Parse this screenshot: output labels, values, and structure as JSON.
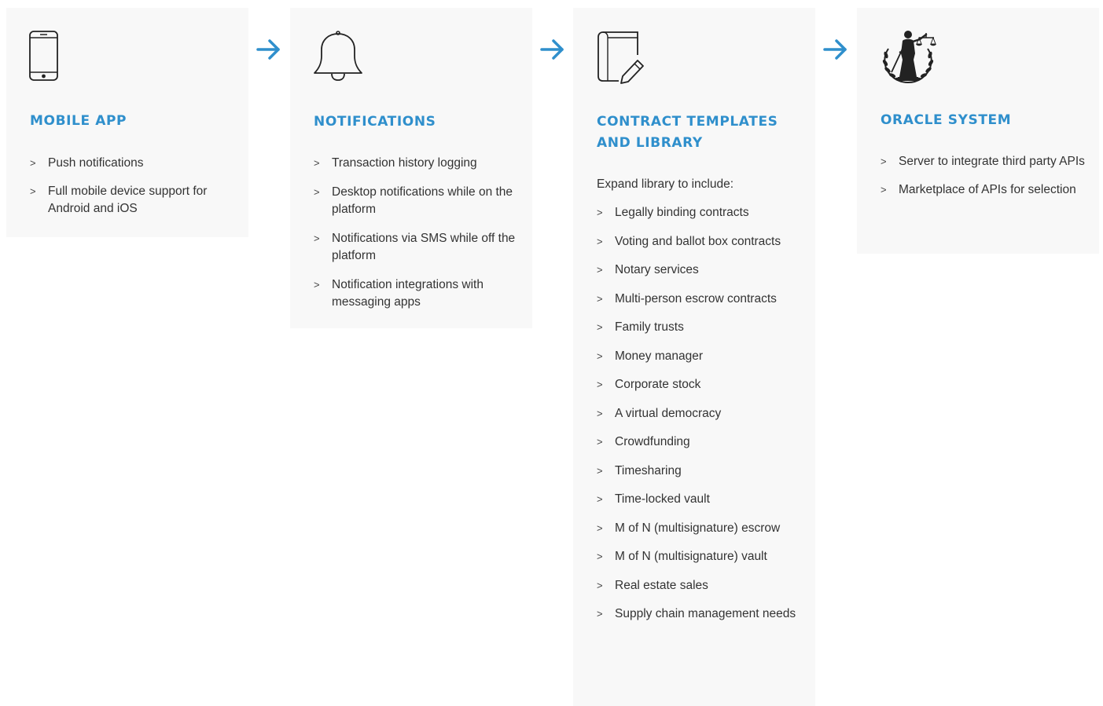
{
  "accent_color": "#2f8fcc",
  "chevron": ">",
  "cards": [
    {
      "title": "MOBILE APP",
      "icon": "mobile-phone-icon",
      "items": [
        "Push notifications",
        "Full mobile device support for Android and iOS"
      ]
    },
    {
      "title": "NOTIFICATIONS",
      "icon": "bell-icon",
      "items": [
        "Transaction history logging",
        "Desktop notifications while on the platform",
        "Notifications via SMS while off the platform",
        "Notification integrations with messaging apps"
      ]
    },
    {
      "title": "CONTRACT TEMPLATES AND LIBRARY",
      "icon": "book-pencil-icon",
      "intro": "Expand library to include:",
      "items": [
        "Legally binding contracts",
        "Voting and ballot box contracts",
        "Notary services",
        "Multi-person escrow contracts",
        "Family trusts",
        "Money manager",
        "Corporate stock",
        "A virtual democracy",
        "Crowdfunding",
        "Timesharing",
        "Time-locked vault",
        "M of N (multisignature) escrow",
        "M of N (multisignature) vault",
        "Real estate sales",
        "Supply chain management needs"
      ]
    },
    {
      "title": "ORACLE SYSTEM",
      "icon": "lady-justice-icon",
      "items": [
        "Server to integrate third party APIs",
        "Marketplace of APIs for selection"
      ]
    }
  ],
  "arrows": [
    "arrow-right-icon",
    "arrow-right-icon",
    "arrow-right-icon"
  ]
}
